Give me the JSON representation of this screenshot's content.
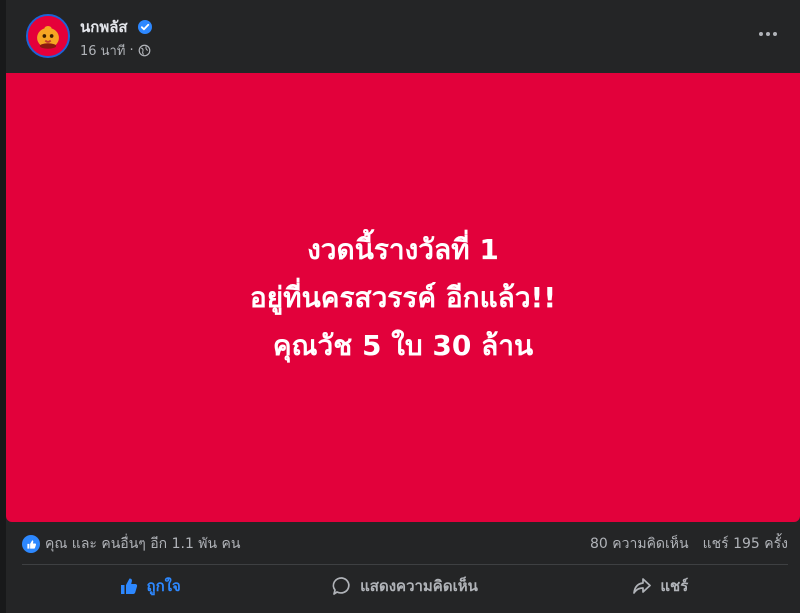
{
  "post": {
    "page_name": "นกพลัส",
    "time": "16 นาที",
    "separator": "·"
  },
  "banner": {
    "lines": [
      "งวดนี้รางวัลที่ 1",
      "อยู่ที่นครสวรรค์ อีกแล้ว!!",
      "คุณวัช 5 ใบ 30 ล้าน"
    ],
    "background": "#e2013b"
  },
  "stats": {
    "reactions": "คุณ และ คนอื่นๆ อีก 1.1 พัน คน",
    "comments": "80 ความคิดเห็น",
    "shares": "แชร์ 195 ครั้ง"
  },
  "actions": {
    "like": "ถูกใจ",
    "comment": "แสดงความคิดเห็น",
    "share": "แชร์"
  },
  "icons": {
    "verified": "verified-badge-icon",
    "privacy": "globe-icon",
    "more": "more-options-icon",
    "like": "thumbs-up-icon",
    "comment": "comment-bubble-icon",
    "share": "share-arrow-icon"
  },
  "colors": {
    "accent": "#2d88ff",
    "card": "#242526",
    "text_secondary": "#b0b3b8"
  }
}
